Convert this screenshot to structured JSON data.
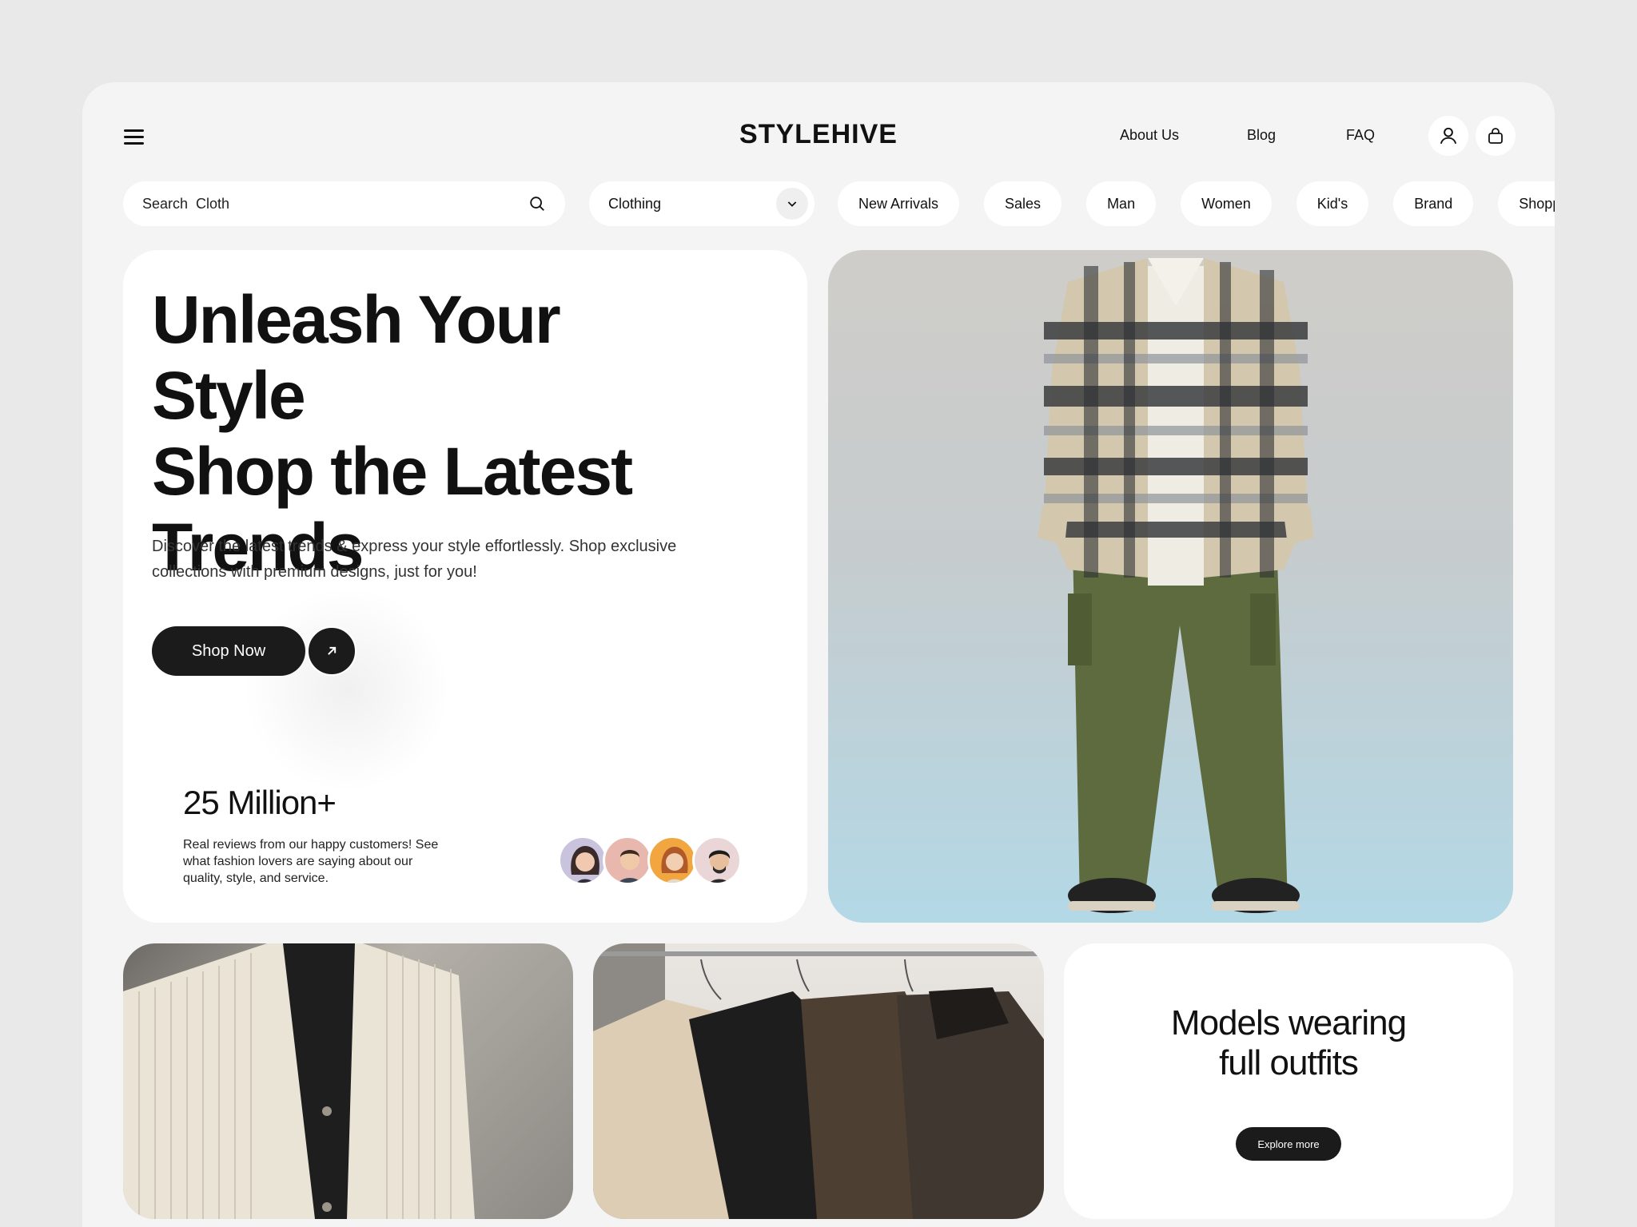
{
  "header": {
    "brand": "STYLEHIVE",
    "nav": [
      "About Us",
      "Blog",
      "FAQ"
    ],
    "icons": [
      "menu-icon",
      "user-icon",
      "shopping-bag-icon"
    ]
  },
  "filters": {
    "search_placeholder": "Search  Cloth",
    "category_select": "Clothing",
    "pills": [
      "New Arrivals",
      "Sales",
      "Man",
      "Women",
      "Kid's",
      "Brand",
      "Shopping"
    ]
  },
  "hero": {
    "title_lines": [
      "Unleash Your Style",
      "Shop the Latest",
      "Trends"
    ],
    "description": "Discover the latest trends & express your style effortlessly. Shop exclusive collections with premium designs, just for you!",
    "cta_label": "Shop Now",
    "stat_value": "25 Million+",
    "stat_description": "Real reviews from our happy customers! See what fashion lovers are saying about our quality, style, and service."
  },
  "promo": {
    "title_lines": [
      "Models wearing",
      "full outfits"
    ],
    "button_label": "Explore more"
  },
  "colors": {
    "page_bg": "#e9e9e9",
    "frame_bg": "#f4f4f4",
    "card_bg": "#ffffff",
    "button_dark": "#1b1b1b"
  }
}
